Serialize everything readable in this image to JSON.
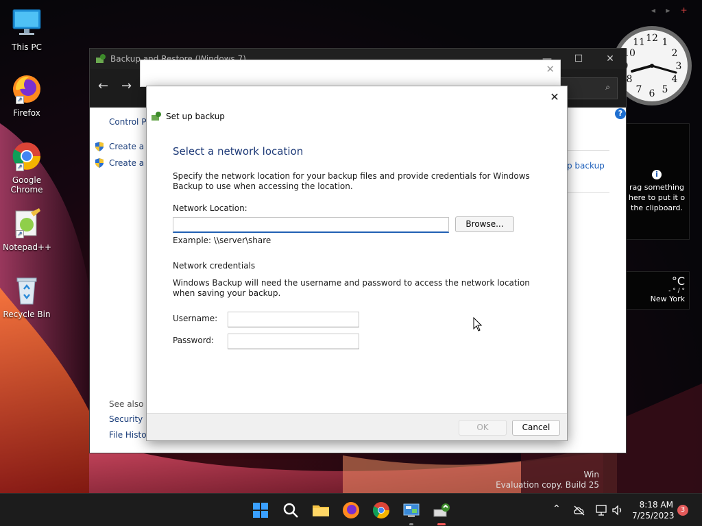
{
  "desktop": {
    "icons": [
      {
        "label": "This PC"
      },
      {
        "label": "Firefox"
      },
      {
        "label": "Google Chrome"
      },
      {
        "label": "Notepad++"
      },
      {
        "label": "Recycle Bin"
      }
    ]
  },
  "gadgets": {
    "clipboard_text": "rag something here to put it o the clipboard.",
    "weather_unit": "°C",
    "weather_sub": "- ° / °",
    "weather_city": "New York"
  },
  "watermark": {
    "line1": "Win",
    "line2": "Evaluation copy. Build 25"
  },
  "backup_window": {
    "title": "Backup and Restore (Windows 7)",
    "left_items": [
      "Control P",
      "Create a",
      "Create a"
    ],
    "see_also": "See also",
    "see_also_items": [
      "Security",
      "File History"
    ],
    "right_link": "p backup"
  },
  "dialog": {
    "window_title": "Set up backup",
    "heading": "Select a network location",
    "description": "Specify the network location for your backup files and provide credentials for Windows Backup to use when accessing the location.",
    "network_location_label": "Network Location:",
    "network_location_value": "",
    "browse_label": "Browse...",
    "example": "Example: \\\\server\\share",
    "credentials_heading": "Network credentials",
    "credentials_description": "Windows Backup will need the username and password to access the network location when saving your backup.",
    "username_label": "Username:",
    "username_value": "",
    "password_label": "Password:",
    "password_value": "",
    "ok_label": "OK",
    "cancel_label": "Cancel"
  },
  "taskbar": {
    "time": "8:18 AM",
    "date": "7/25/2023",
    "notification_count": "3"
  },
  "colors": {
    "accent": "#1f5fb3",
    "heading": "#1f3b78",
    "taskbar": "#1c1c1c"
  }
}
